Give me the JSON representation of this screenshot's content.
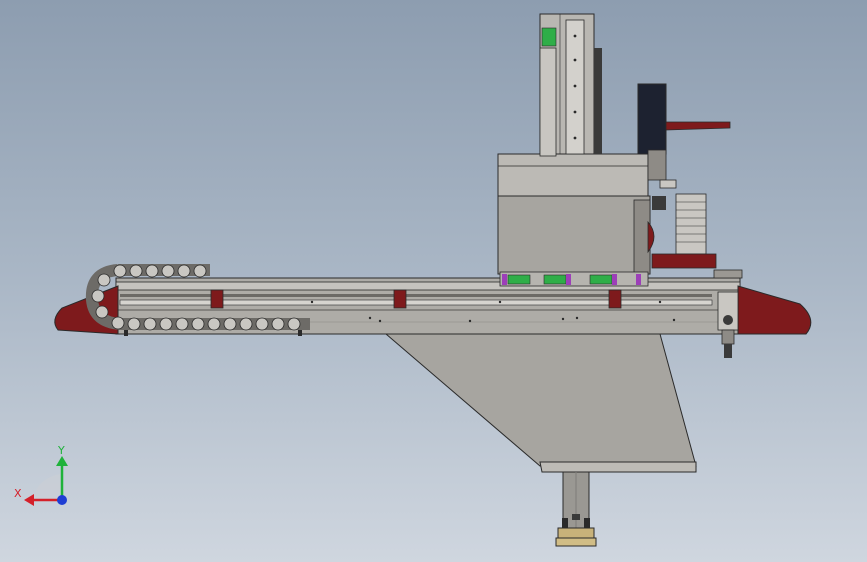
{
  "viewport": {
    "background_top": "#8d9db0",
    "background_bottom": "#cfd6df"
  },
  "colors": {
    "steel": "#a9a7a2",
    "steel_dark": "#8e8b86",
    "steel_light": "#c9c7c2",
    "outline": "#2a2a2a",
    "cap_red": "#7e1a1c",
    "accent_green": "#2fae48",
    "accent_purple": "#9c3fb8",
    "motor_black": "#1d2230",
    "bracket_gray": "#9b9893"
  },
  "triad": {
    "x_label": "X",
    "y_label": "Y",
    "x_color": "#d4202a",
    "y_color": "#1fb23a",
    "z_color": "#1e3ed4"
  },
  "icons": {
    "view_triad": "coordinate-triad-icon"
  }
}
